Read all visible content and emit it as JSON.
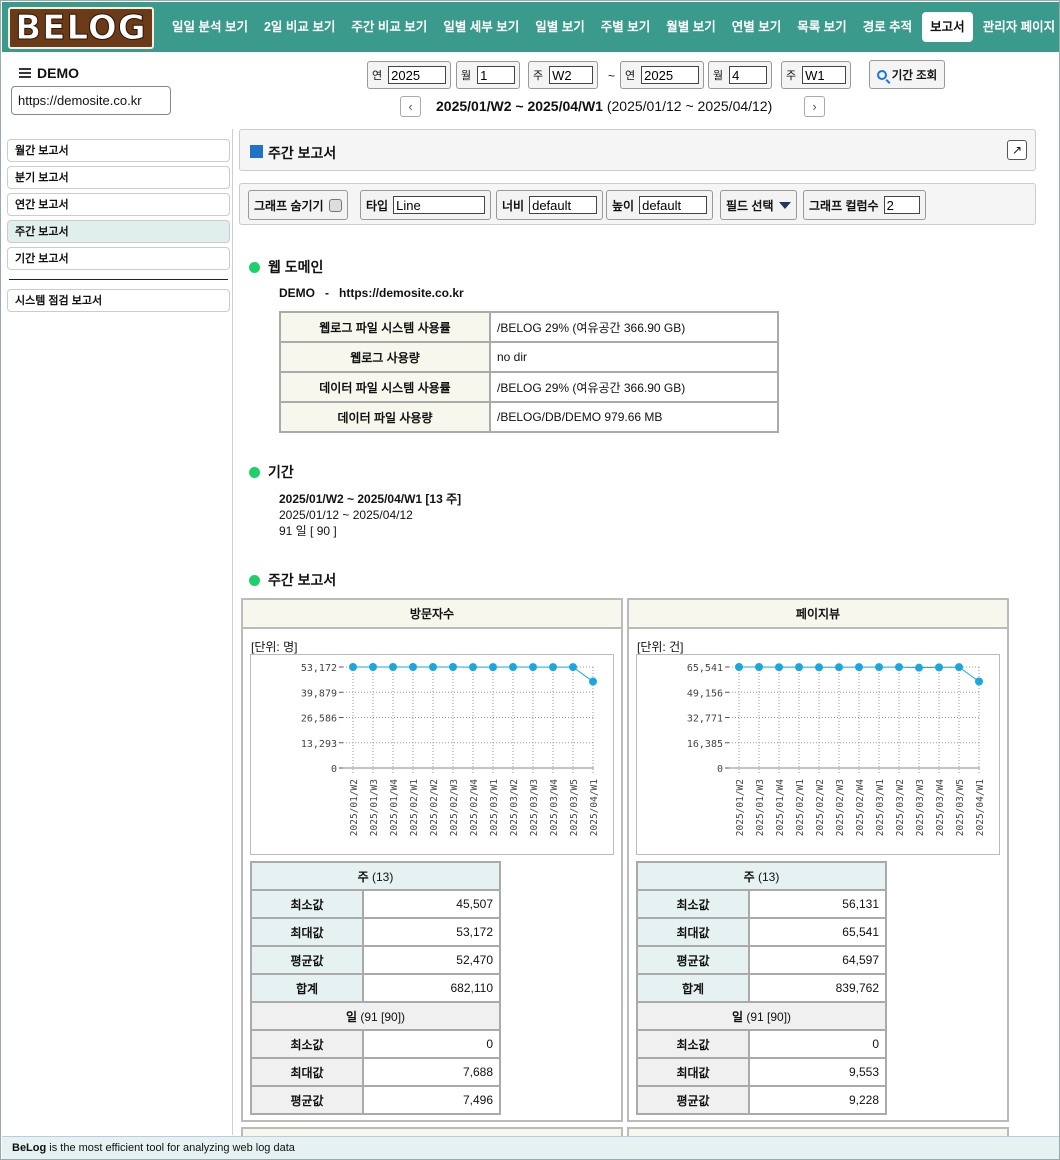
{
  "app": {
    "logo": "BELOG"
  },
  "nav": [
    "일일 분석 보기",
    "2일 비교 보기",
    "주간 비교 보기",
    "일별 세부 보기",
    "일별 보기",
    "주별 보기",
    "월별 보기",
    "연별 보기",
    "목록 보기",
    "경로 추적",
    "보고서",
    "관리자 페이지"
  ],
  "nav_active": "보고서",
  "site": {
    "name": "DEMO",
    "url": "https://demosite.co.kr"
  },
  "date_from": {
    "year_label": "연",
    "year": "2025",
    "month_label": "월",
    "month": "1",
    "week_label": "주",
    "week": "W2"
  },
  "date_to": {
    "year_label": "연",
    "year": "2025",
    "month_label": "월",
    "month": "4",
    "week_label": "주",
    "week": "W1"
  },
  "tilde": "~",
  "search_label": "기간 조회",
  "range": {
    "title": "2025/01/W2 ~ 2025/04/W1",
    "dates": "(2025/01/12 ~ 2025/04/12)"
  },
  "sidebar": {
    "items": [
      "월간 보고서",
      "분기 보고서",
      "연간 보고서",
      "주간 보고서",
      "기간 보고서"
    ],
    "active": "주간 보고서",
    "extra": "시스템 점검 보고서"
  },
  "report": {
    "title": "주간 보고서"
  },
  "toolbar": {
    "hide_graph": "그래프 숨기기",
    "type_label": "타입",
    "type_value": "Line",
    "width_label": "너비",
    "width_value": "default",
    "height_label": "높이",
    "height_value": "default",
    "field_select": "필드 선택",
    "columns_label": "그래프 컬럼수",
    "columns_value": "2"
  },
  "web_domain": {
    "heading": "웹 도메인",
    "line": "DEMO   -   https://demosite.co.kr",
    "rows": [
      {
        "k": "웹로그 파일 시스템 사용률",
        "v": "/BELOG 29% (여유공간 366.90 GB)"
      },
      {
        "k": "웹로그 사용량",
        "v": "no dir"
      },
      {
        "k": "데이터 파일 시스템 사용률",
        "v": "/BELOG 29% (여유공간 366.90 GB)"
      },
      {
        "k": "데이터 파일 사용량",
        "v": "/BELOG/DB/DEMO 979.66 MB"
      }
    ]
  },
  "period": {
    "heading": "기간",
    "line1": "2025/01/W2 ~ 2025/04/W1 [13 주]",
    "line2": "2025/01/12 ~ 2025/04/12",
    "line3": "91 일 [ 90 ]"
  },
  "weekly": {
    "heading": "주간 보고서"
  },
  "chart_data": [
    {
      "type": "line",
      "title": "방문자수",
      "unit": "[단위: 명]",
      "categories": [
        "2025/01/W2",
        "2025/01/W3",
        "2025/01/W4",
        "2025/02/W1",
        "2025/02/W2",
        "2025/02/W3",
        "2025/02/W4",
        "2025/03/W1",
        "2025/03/W2",
        "2025/03/W3",
        "2025/03/W4",
        "2025/03/W5",
        "2025/04/W1"
      ],
      "values": [
        53172,
        53172,
        53172,
        53172,
        53172,
        53172,
        53100,
        53110,
        53150,
        53120,
        53100,
        53130,
        45507
      ],
      "yticks": [
        "0",
        "13,293",
        "26,586",
        "39,879",
        "53,172"
      ],
      "ylim": [
        0,
        53172
      ],
      "color": "#1aa7e0",
      "stats": {
        "week_header": "주",
        "week_count": "(13)",
        "week_rows": [
          {
            "k": "최소값",
            "v": "45,507"
          },
          {
            "k": "최대값",
            "v": "53,172"
          },
          {
            "k": "평균값",
            "v": "52,470"
          },
          {
            "k": "합계",
            "v": "682,110"
          }
        ],
        "day_header": "일",
        "day_count": "(91 [90])",
        "day_rows": [
          {
            "k": "최소값",
            "v": "0"
          },
          {
            "k": "최대값",
            "v": "7,688"
          },
          {
            "k": "평균값",
            "v": "7,496"
          }
        ]
      }
    },
    {
      "type": "line",
      "title": "페이지뷰",
      "unit": "[단위: 건]",
      "categories": [
        "2025/01/W2",
        "2025/01/W3",
        "2025/01/W4",
        "2025/02/W1",
        "2025/02/W2",
        "2025/02/W3",
        "2025/02/W4",
        "2025/03/W1",
        "2025/03/W2",
        "2025/03/W3",
        "2025/03/W4",
        "2025/03/W5",
        "2025/04/W1"
      ],
      "values": [
        65541,
        65541,
        65400,
        65450,
        65350,
        65400,
        65450,
        65480,
        65500,
        65100,
        65300,
        65450,
        56131
      ],
      "yticks": [
        "0",
        "16,385",
        "32,771",
        "49,156",
        "65,541"
      ],
      "ylim": [
        0,
        65541
      ],
      "color": "#1aa7e0",
      "stats": {
        "week_header": "주",
        "week_count": "(13)",
        "week_rows": [
          {
            "k": "최소값",
            "v": "56,131"
          },
          {
            "k": "최대값",
            "v": "65,541"
          },
          {
            "k": "평균값",
            "v": "64,597"
          },
          {
            "k": "합계",
            "v": "839,762"
          }
        ],
        "day_header": "일",
        "day_count": "(91 [90])",
        "day_rows": [
          {
            "k": "최소값",
            "v": "0"
          },
          {
            "k": "최대값",
            "v": "9,553"
          },
          {
            "k": "평균값",
            "v": "9,228"
          }
        ]
      }
    }
  ],
  "footer": {
    "brand": "BeLog",
    "text": " is the most efficient tool for analyzing web log data"
  }
}
